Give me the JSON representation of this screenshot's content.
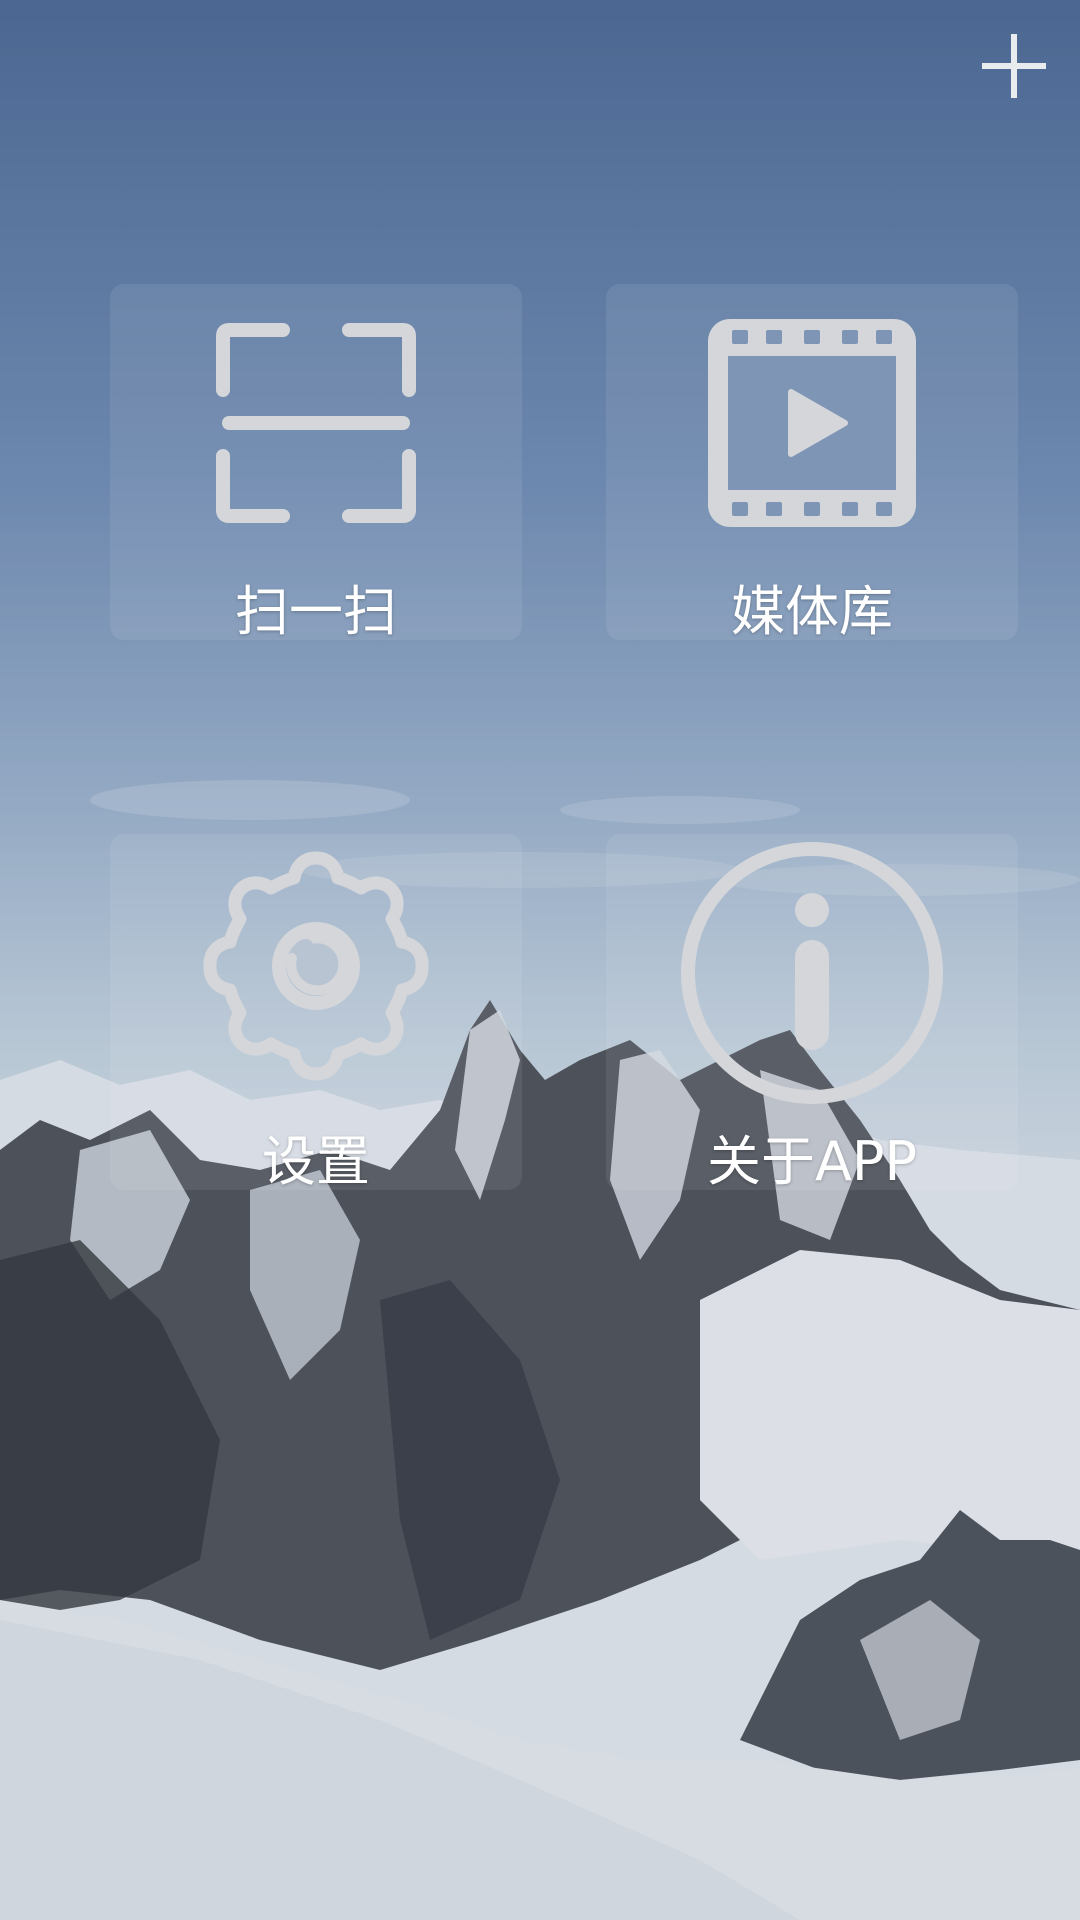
{
  "header": {
    "add_icon": "plus-icon"
  },
  "menu": {
    "items": [
      {
        "label": "扫一扫",
        "icon": "scan-icon"
      },
      {
        "label": "媒体库",
        "icon": "video-library-icon"
      },
      {
        "label": "设置",
        "icon": "gear-icon"
      },
      {
        "label": "关于APP",
        "icon": "info-icon"
      }
    ]
  },
  "colors": {
    "icon": "#d4d6da",
    "label": "#ffffff",
    "sky_top": "#4a6794",
    "snow": "#f1f2f4"
  }
}
